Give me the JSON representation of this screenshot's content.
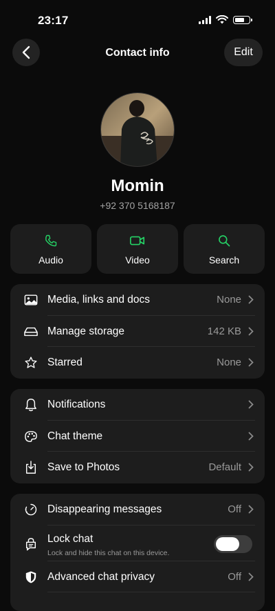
{
  "status": {
    "time": "23:17"
  },
  "nav": {
    "title": "Contact info",
    "edit_label": "Edit"
  },
  "contact": {
    "name": "Momin",
    "phone": "+92 370 5168187"
  },
  "actions": [
    {
      "label": "Audio",
      "icon": "phone-icon"
    },
    {
      "label": "Video",
      "icon": "video-icon"
    },
    {
      "label": "Search",
      "icon": "search-icon"
    }
  ],
  "group1": [
    {
      "label": "Media, links and docs",
      "value": "None",
      "icon": "image-icon"
    },
    {
      "label": "Manage storage",
      "value": "142 KB",
      "icon": "storage-icon"
    },
    {
      "label": "Starred",
      "value": "None",
      "icon": "star-icon"
    }
  ],
  "group2": [
    {
      "label": "Notifications",
      "value": "",
      "icon": "bell-icon"
    },
    {
      "label": "Chat theme",
      "value": "",
      "icon": "palette-icon"
    },
    {
      "label": "Save to Photos",
      "value": "Default",
      "icon": "download-icon"
    }
  ],
  "group3": [
    {
      "label": "Disappearing messages",
      "value": "Off",
      "icon": "timer-icon"
    },
    {
      "label": "Lock chat",
      "subtitle": "Lock and hide this chat on this device.",
      "icon": "lock-chat-icon",
      "toggle_on": false
    },
    {
      "label": "Advanced chat privacy",
      "value": "Off",
      "icon": "shield-icon"
    }
  ],
  "colors": {
    "accent": "#25d366",
    "background": "#0b0b0b",
    "card": "#1d1d1d"
  }
}
